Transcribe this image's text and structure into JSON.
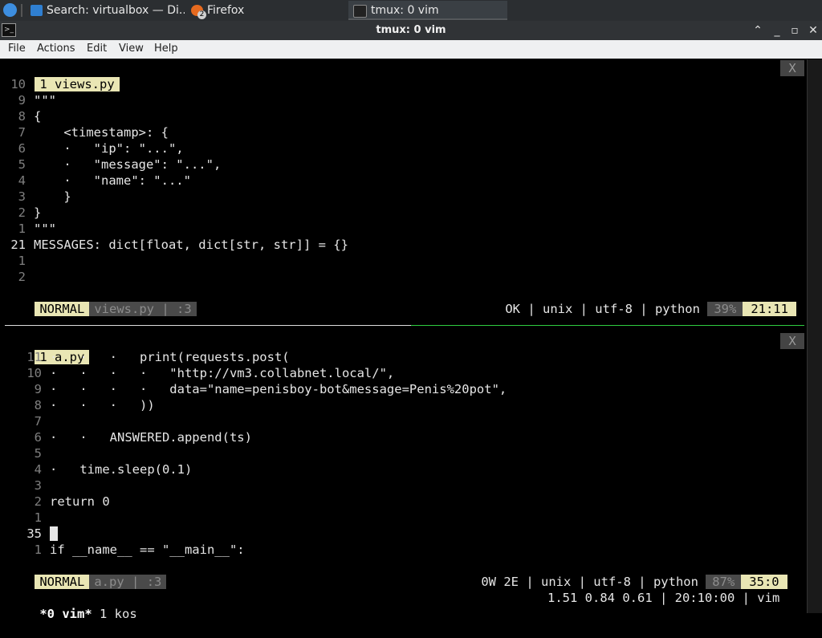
{
  "taskbar": {
    "tasks": [
      {
        "label": "Search: virtualbox — Di..."
      },
      {
        "label": "Firefox",
        "badge": "2"
      },
      {
        "label": "tmux: 0 vim"
      }
    ]
  },
  "window": {
    "title": "tmux: 0 vim"
  },
  "menu": [
    "File",
    "Actions",
    "Edit",
    "View",
    "Help"
  ],
  "pane1": {
    "tab_num": "1",
    "tab_name": "views.py",
    "close_label": "X",
    "lines": [
      {
        "num": "10",
        "text": ""
      },
      {
        "num": "9",
        "text": "\"\"\""
      },
      {
        "num": "8",
        "text": "{"
      },
      {
        "num": "7",
        "text": "    <timestamp>: {"
      },
      {
        "num": "6",
        "text": "    ·   \"ip\": \"...\","
      },
      {
        "num": "5",
        "text": "    ·   \"message\": \"...\","
      },
      {
        "num": "4",
        "text": "    ·   \"name\": \"...\""
      },
      {
        "num": "3",
        "text": "    }"
      },
      {
        "num": "2",
        "text": "}"
      },
      {
        "num": "1",
        "text": "\"\"\""
      },
      {
        "num": "21",
        "text": "MESSAGES: dict[float, dict[str, str]] = {}"
      },
      {
        "num": "1",
        "text": ""
      },
      {
        "num": "2",
        "text": ""
      }
    ],
    "status": {
      "mode": "NORMAL",
      "file": "views.py",
      "sep": "|",
      "extra": ":3",
      "right": "OK | unix | utf-8 | python",
      "percent": "39%",
      "position": "21:11"
    }
  },
  "pane2": {
    "tab_num": "1",
    "tab_name": "a.py",
    "close_label": "X",
    "lines": [
      {
        "num": "11",
        "text": "·   ·   ·   print(requests.post("
      },
      {
        "num": "10",
        "text": "·   ·   ·   ·   \"http://vm3.collabnet.local/\","
      },
      {
        "num": "9",
        "text": "·   ·   ·   ·   data=\"name=penisboy-bot&message=Penis%20pot\","
      },
      {
        "num": "8",
        "text": "·   ·   ·   ))"
      },
      {
        "num": "7",
        "text": ""
      },
      {
        "num": "6",
        "text": "·   ·   ANSWERED.append(ts)"
      },
      {
        "num": "5",
        "text": ""
      },
      {
        "num": "4",
        "text": "·   time.sleep(0.1)"
      },
      {
        "num": "3",
        "text": ""
      },
      {
        "num": "2",
        "text": "return 0"
      },
      {
        "num": "1",
        "text": ""
      },
      {
        "num": "35",
        "text": ""
      },
      {
        "num": "1",
        "text": "if __name__ == \"__main__\":"
      }
    ],
    "status": {
      "mode": "NORMAL",
      "file": "a.py",
      "sep": "|",
      "extra": ":3",
      "right": "0W 2E | unix | utf-8 | python",
      "percent": "87%",
      "position": "35:0"
    }
  },
  "tmux": {
    "window_active": "*0 vim*",
    "window_other": "1 kos",
    "right": "1.51 0.84 0.61 | 20:10:00 | vim"
  }
}
